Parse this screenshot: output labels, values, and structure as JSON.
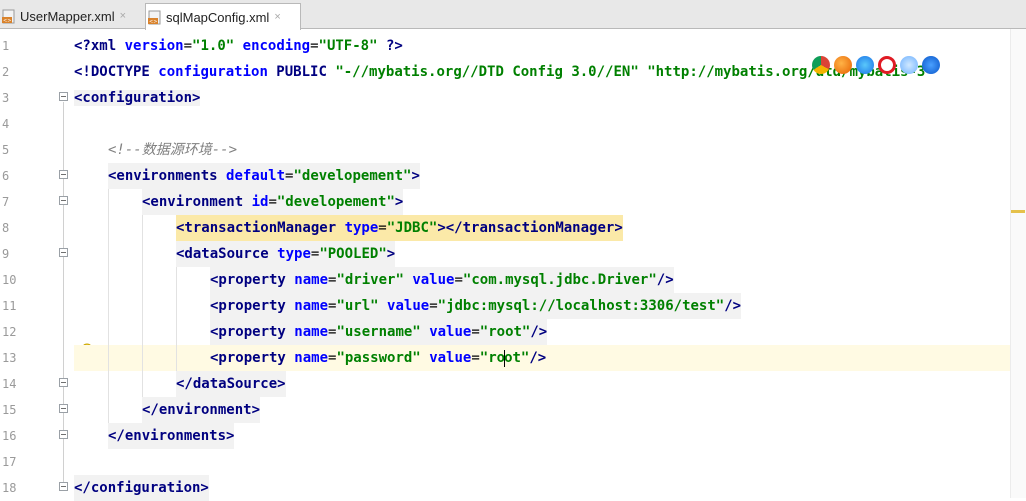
{
  "tabs": [
    {
      "label": "UserMapper.xml",
      "close": "×",
      "active": false
    },
    {
      "label": "sqlMapConfig.xml",
      "close": "×",
      "active": true
    }
  ],
  "line_numbers": [
    "1",
    "2",
    "3",
    "4",
    "5",
    "6",
    "7",
    "8",
    "9",
    "10",
    "11",
    "12",
    "13",
    "14",
    "15",
    "16",
    "17",
    "18"
  ],
  "code": {
    "l1": {
      "open": "<?",
      "name": "xml",
      "a1": "version",
      "eq1": "=",
      "v1": "\"1.0\"",
      "a2": "encoding",
      "eq2": "=",
      "v2": "\"UTF-8\"",
      "close": " ?>"
    },
    "l2": {
      "text1": "<!DOCTYPE ",
      "name": "configuration",
      "kw": " PUBLIC ",
      "v1": "\"-//mybatis.org//DTD Config 3.0//EN\"",
      "sp": " ",
      "v2": "\"http://mybatis.org/dtd/mybatis-3-"
    },
    "l3": {
      "text": "<configuration>"
    },
    "l5": {
      "text": "<!--数据源环境-->"
    },
    "l6": {
      "open": "<environments ",
      "a1": "default",
      "eq": "=",
      "v1": "\"developement\"",
      "close": ">"
    },
    "l7": {
      "open": "<environment ",
      "a1": "id",
      "eq": "=",
      "v1": "\"developement\"",
      "close": ">"
    },
    "l8": {
      "open": "<transactionManager ",
      "a1": "type",
      "eq": "=",
      "v1": "\"JDBC\"",
      "close": "></transactionManager>"
    },
    "l9": {
      "open": "<dataSource ",
      "a1": "type",
      "eq": "=",
      "v1": "\"POOLED\"",
      "close": ">"
    },
    "l10": {
      "open": "<property ",
      "a1": "name",
      "eq1": "=",
      "v1": "\"driver\"",
      "a2": "value",
      "eq2": "=",
      "v2": "\"com.mysql.jdbc.Driver\"",
      "close": "/>"
    },
    "l11": {
      "open": "<property ",
      "a1": "name",
      "eq1": "=",
      "v1": "\"url\"",
      "a2": "value",
      "eq2": "=",
      "v2": "\"jdbc:mysql://localhost:3306/test\"",
      "close": "/>"
    },
    "l12": {
      "open": "<property ",
      "a1": "name",
      "eq1": "=",
      "v1": "\"username\"",
      "a2": "value",
      "eq2": "=",
      "v2": "\"root\"",
      "close": "/>"
    },
    "l13": {
      "open": "<property ",
      "a1": "name",
      "eq1": "=",
      "v1": "\"password\"",
      "a2": "value",
      "eq2": "=",
      "v2a": "\"ro",
      "v2b": "ot\"",
      "close": "/>"
    },
    "l14": {
      "text": "</dataSource>"
    },
    "l15": {
      "text": "</environment>"
    },
    "l16": {
      "text": "</environments>"
    },
    "l18": {
      "text": "</configuration>"
    }
  },
  "browser_icons": [
    "chrome-icon",
    "firefox-icon",
    "safari-icon",
    "opera-icon",
    "ie-icon",
    "edge-icon"
  ],
  "colors": {
    "tag": "#000080",
    "attribute": "#0000ff",
    "value": "#008000",
    "comment": "#808080",
    "current_line": "#fffae3",
    "tag_highlight": "#fbe9a8"
  }
}
